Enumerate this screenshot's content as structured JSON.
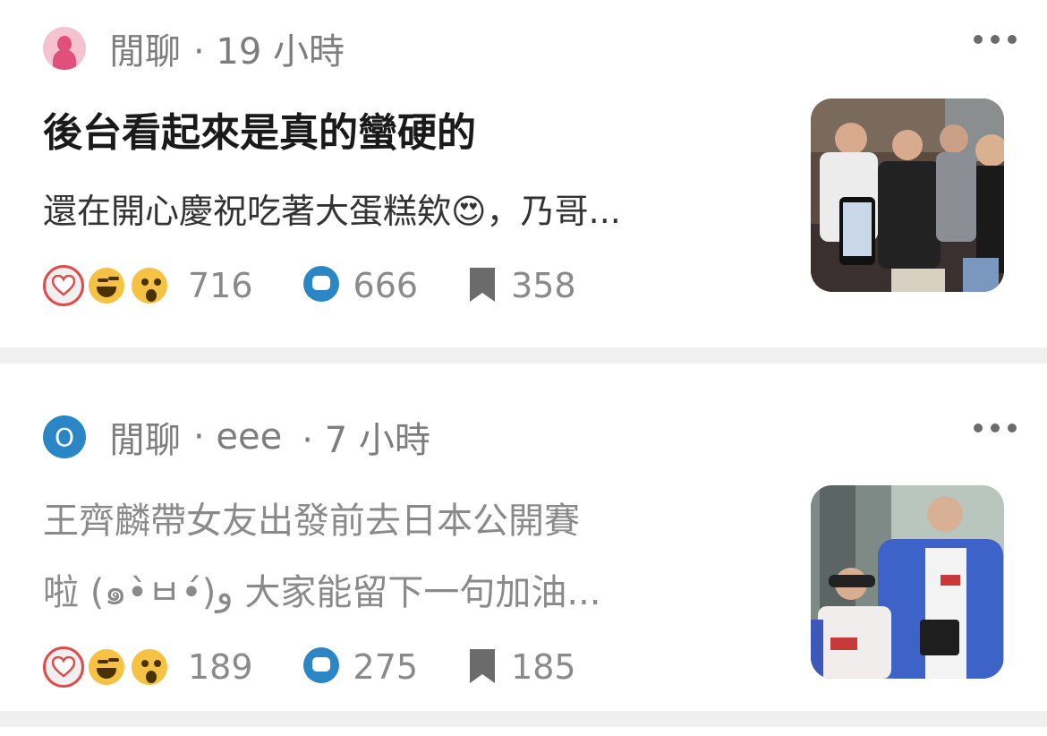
{
  "posts": [
    {
      "board": "閒聊",
      "author": "",
      "time": "· 19 小時",
      "title": "後台看起來是真的蠻硬的",
      "excerpt_lines": [
        "還在開心慶祝吃著大蛋糕欸😍，乃哥..."
      ],
      "reactions": "716",
      "comments": "666",
      "saves": "358"
    },
    {
      "board": "閒聊",
      "author": "· eee",
      "avatar_letter": "O",
      "time": "· 7 小時",
      "excerpt_lines": [
        "王齊麟帶女友出發前去日本公開賽",
        "啦 (๑•̀ㅂ•́)و 大家能留下一句加油..."
      ],
      "reactions": "189",
      "comments": "275",
      "saves": "185"
    }
  ],
  "colors": {
    "heart": "#e24a4a",
    "comment_icon": "#2b86c5",
    "avatar_pink": "#f4c3cf",
    "avatar_blue": "#2b86c5"
  }
}
